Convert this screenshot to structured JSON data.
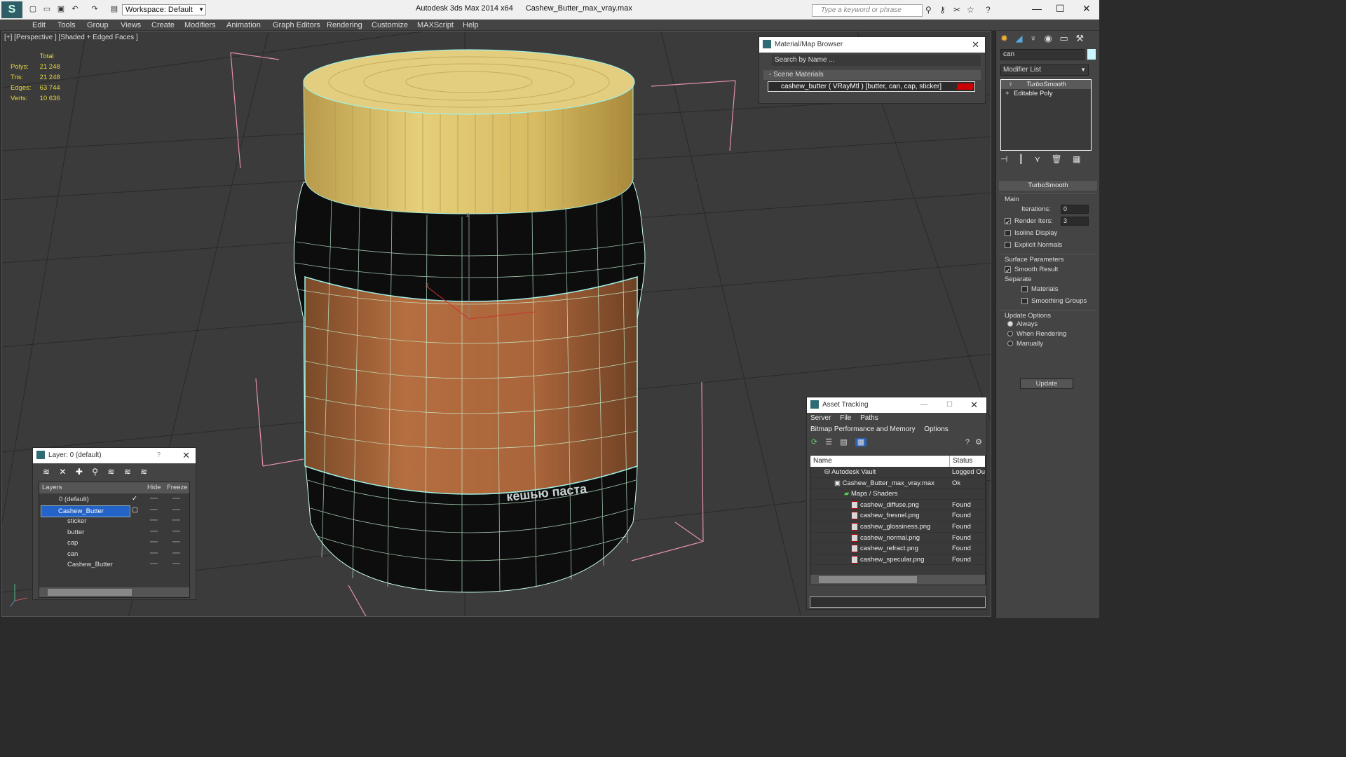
{
  "titlebar": {
    "workspace": "Workspace: Default",
    "app_name": "Autodesk 3ds Max  2014 x64",
    "file_name": "Cashew_Butter_max_vray.max",
    "search_placeholder": "Type a keyword or phrase"
  },
  "menu": [
    "Edit",
    "Tools",
    "Group",
    "Views",
    "Create",
    "Modifiers",
    "Animation",
    "Graph Editors",
    "Rendering",
    "Customize",
    "MAXScript",
    "Help"
  ],
  "viewport": {
    "label": "[+] [Perspective ] [Shaded + Edged Faces ]",
    "stats": {
      "header": "Total",
      "polys_label": "Polys:",
      "polys": "21 248",
      "tris_label": "Tris:",
      "tris": "21 248",
      "edges_label": "Edges:",
      "edges": "63 744",
      "verts_label": "Verts:",
      "verts": "10 636"
    },
    "axis_z": "z",
    "axis_x": "x",
    "label_text": "кешью паста"
  },
  "material_browser": {
    "title": "Material/Map Browser",
    "search": "Search by Name ...",
    "section": "Scene Materials",
    "material": "cashew_butter  ( VRayMtl )  [butter, can, cap, sticker]"
  },
  "layers": {
    "title": "Layer: 0 (default)",
    "help": "?",
    "col_layers": "Layers",
    "col_hide": "Hide",
    "col_freeze": "Freeze",
    "rows": [
      "0 (default)",
      "Cashew_Butter",
      "sticker",
      "butter",
      "cap",
      "can",
      "Cashew_Butter"
    ]
  },
  "asset_tracking": {
    "title": "Asset Tracking",
    "menu1": [
      "Server",
      "File",
      "Paths"
    ],
    "menu2": [
      "Bitmap Performance and Memory",
      "Options"
    ],
    "col_name": "Name",
    "col_status": "Status",
    "rows": [
      {
        "name": "Autodesk Vault",
        "status": "Logged Ou"
      },
      {
        "name": "Cashew_Butter_max_vray.max",
        "status": "Ok"
      },
      {
        "name": "Maps / Shaders",
        "status": ""
      },
      {
        "name": "cashew_diffuse.png",
        "status": "Found"
      },
      {
        "name": "cashew_fresnel.png",
        "status": "Found"
      },
      {
        "name": "cashew_glossiness.png",
        "status": "Found"
      },
      {
        "name": "cashew_normal.png",
        "status": "Found"
      },
      {
        "name": "cashew_refract.png",
        "status": "Found"
      },
      {
        "name": "cashew_specular.png",
        "status": "Found"
      }
    ]
  },
  "command_panel": {
    "object_name": "can",
    "modifier_list": "Modifier List",
    "stack": [
      "TurboSmooth",
      "Editable Poly"
    ],
    "rollout_title": "TurboSmooth",
    "main_label": "Main",
    "iterations_label": "Iterations:",
    "iterations": "0",
    "render_iters_label": "Render Iters:",
    "render_iters": "3",
    "isoline": "Isoline Display",
    "explicit_normals": "Explicit Normals",
    "surface_params": "Surface Parameters",
    "smooth_result": "Smooth Result",
    "separate": "Separate",
    "materials": "Materials",
    "smoothing_groups": "Smoothing Groups",
    "update_options": "Update Options",
    "always": "Always",
    "when_rendering": "When Rendering",
    "manually": "Manually",
    "update_button": "Update"
  }
}
